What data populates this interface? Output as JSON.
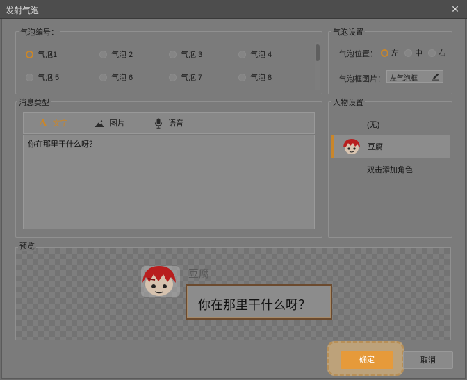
{
  "window": {
    "title": "发射气泡",
    "close_icon": "close-icon"
  },
  "bubble_number": {
    "label": "气泡编号：",
    "options": [
      "气泡1",
      "气泡 2",
      "气泡 3",
      "气泡 4",
      "气泡 5",
      "气泡 6",
      "气泡 7",
      "气泡 8"
    ],
    "selected": "气泡1"
  },
  "bubble_settings": {
    "label": "气泡设置",
    "position_label": "气泡位置：",
    "positions": [
      "左",
      "中",
      "右"
    ],
    "selected_position": "左",
    "frame_label": "气泡框图片：",
    "frame_value": "左气泡框",
    "frame_edit_icon": "pencil-icon"
  },
  "message_type": {
    "label": "消息类型",
    "tabs": [
      {
        "label": "文字",
        "icon": "text-icon"
      },
      {
        "label": "图片",
        "icon": "image-icon"
      },
      {
        "label": "语音",
        "icon": "microphone-icon"
      }
    ],
    "active_tab": "文字",
    "content": "你在那里干什么呀？"
  },
  "character_settings": {
    "label": "人物设置",
    "items": [
      {
        "label": "(无)"
      },
      {
        "label": "豆腐",
        "avatar": "avatar"
      },
      {
        "label": "双击添加角色"
      }
    ],
    "selected": "豆腐"
  },
  "preview": {
    "label": "预览",
    "name": "豆腐",
    "text": "你在那里干什么呀？"
  },
  "buttons": {
    "ok": "确定",
    "cancel": "取消"
  },
  "colors": {
    "accent": "#e69a3a",
    "bubble_border": "#6b4a2e"
  }
}
